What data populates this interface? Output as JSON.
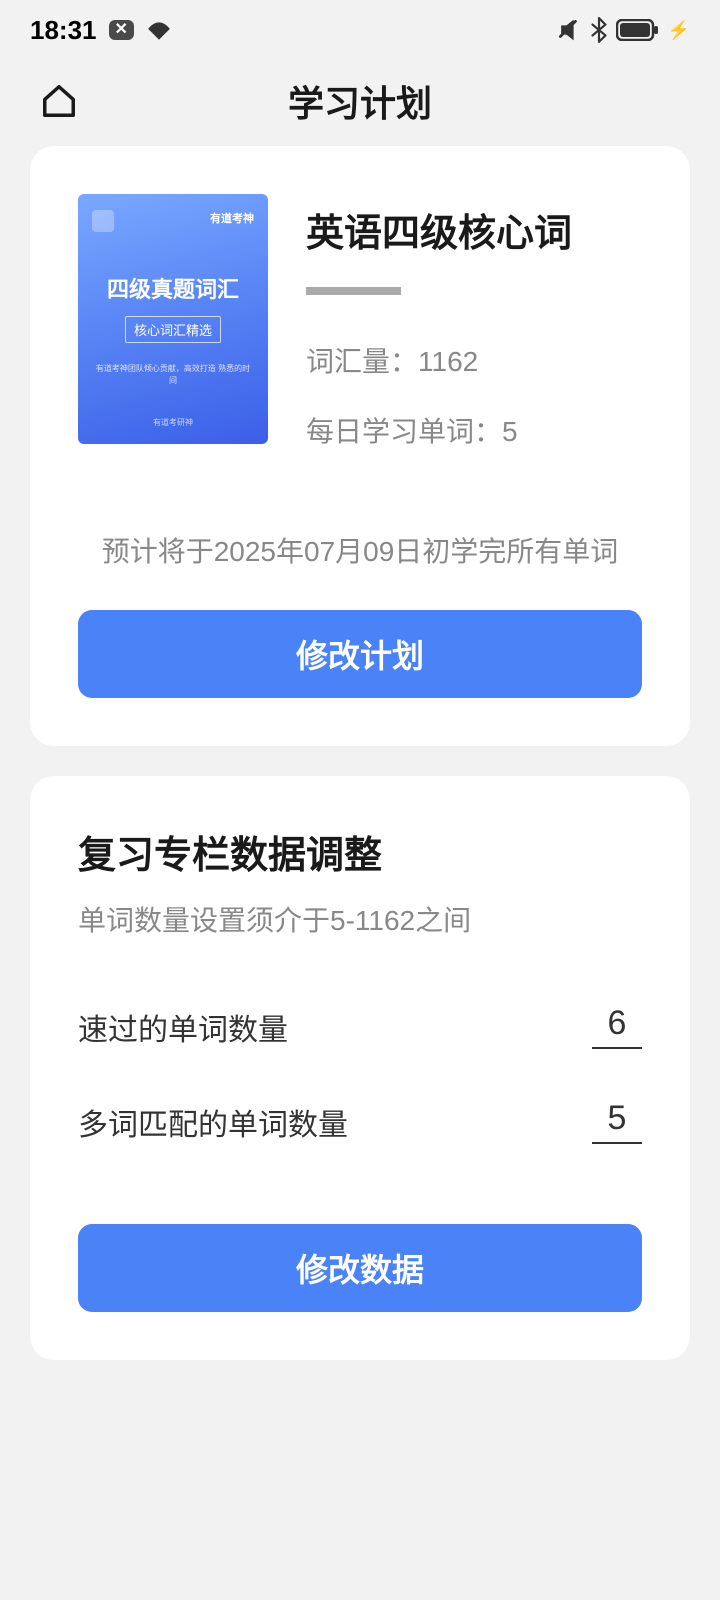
{
  "status": {
    "time": "18:31"
  },
  "header": {
    "title": "学习计划"
  },
  "plan": {
    "book_cover": {
      "brand": "有道考神",
      "title": "四级真题词汇",
      "subtitle": "核心词汇精选",
      "desc": "有道考神团队倾心贡献，高效打造\n熟悉的时间",
      "footer": "有道考研神"
    },
    "book_title": "英语四级核心词",
    "vocab_label": "词汇量：",
    "vocab_value": "1162",
    "daily_label": "每日学习单词：",
    "daily_value": "5",
    "forecast": "预计将于2025年07月09日初学完所有单词",
    "modify_button": "修改计划"
  },
  "review": {
    "title": "复习专栏数据调整",
    "subtitle": "单词数量设置须介于5-1162之间",
    "fast_label": "速过的单词数量",
    "fast_value": "6",
    "match_label": "多词匹配的单词数量",
    "match_value": "5",
    "modify_button": "修改数据"
  }
}
